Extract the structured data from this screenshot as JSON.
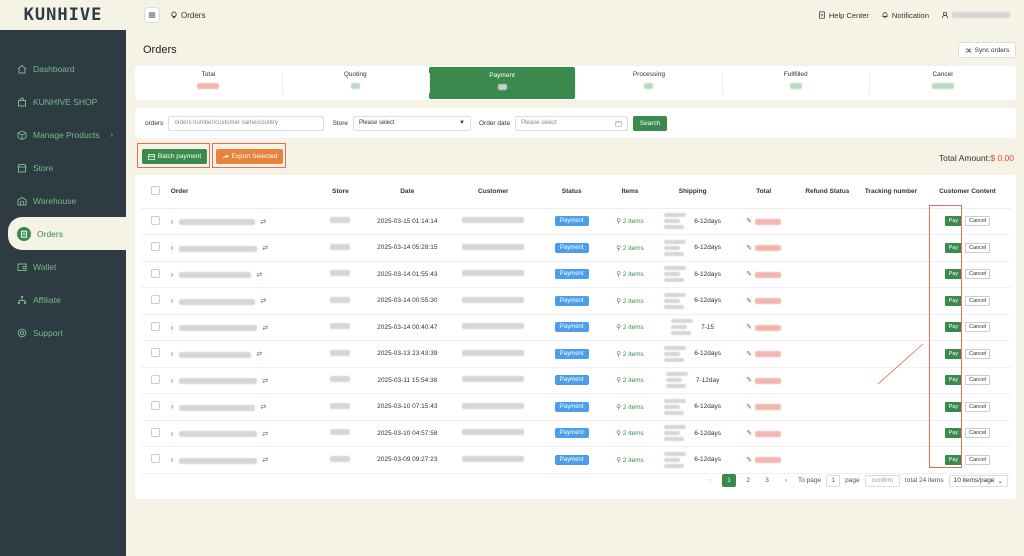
{
  "app": {
    "logo": "KUNHIVE"
  },
  "sidebar": {
    "items": [
      {
        "label": "Dashboard",
        "icon": "home-icon"
      },
      {
        "label": "KUNHIVE SHOP",
        "icon": "bag-icon"
      },
      {
        "label": "Manage Products",
        "icon": "box-icon",
        "chevron": "›"
      },
      {
        "label": "Store",
        "icon": "store-icon"
      },
      {
        "label": "Warehouse",
        "icon": "warehouse-icon"
      },
      {
        "label": "Orders",
        "icon": "clipboard-icon",
        "active": true
      },
      {
        "label": "Wallet",
        "icon": "wallet-icon"
      },
      {
        "label": "Affiliate",
        "icon": "network-icon"
      },
      {
        "label": "Support",
        "icon": "support-icon"
      }
    ]
  },
  "header": {
    "breadcrumb": "Orders",
    "help_center": "Help Center",
    "notification": "Notification"
  },
  "page": {
    "title": "Orders",
    "sync_label": "Sync orders"
  },
  "stats": [
    {
      "label": "Total",
      "color": "#f3b7ae"
    },
    {
      "label": "Quoting",
      "color": "#b9d9c0"
    },
    {
      "label": "Payment",
      "color": "#cfcfcf",
      "active": true
    },
    {
      "label": "Processing",
      "color": "#b9d9c0"
    },
    {
      "label": "Fullfilled",
      "color": "#b9d9c0"
    },
    {
      "label": "Cancel",
      "color": "#b9d9c0"
    }
  ],
  "filters": {
    "orders_label": "orders",
    "orders_placeholder": "orders number/customer name/country",
    "store_label": "Store",
    "store_value": "Please select",
    "order_date_label": "Order date",
    "order_date_placeholder": "Please select",
    "search_label": "Search"
  },
  "actions": {
    "batch_payment": "Batch payment",
    "export_selected": "Export Selected",
    "total_amount_label": "Total Amount:",
    "total_amount_value": "$ 0.00"
  },
  "table": {
    "columns": [
      "Order",
      "Store",
      "Date",
      "Customer",
      "Status",
      "Items",
      "Shipping",
      "Total",
      "Refund Status",
      "Tracking number",
      "Customer Content"
    ],
    "rows": [
      {
        "date": "2025-03-15 01:14:14",
        "status": "Payment",
        "items": "2 items",
        "shipping": "6-12days",
        "pay": "Pay",
        "cancel": "Cancel"
      },
      {
        "date": "2025-03-14 05:28:15",
        "status": "Payment",
        "items": "2 items",
        "shipping": "6-12days",
        "pay": "Pay",
        "cancel": "Cancel"
      },
      {
        "date": "2025-03-14 01:55:43",
        "status": "Payment",
        "items": "2 items",
        "shipping": "6-12days",
        "pay": "Pay",
        "cancel": "Cancel"
      },
      {
        "date": "2025-03-14 00:55:30",
        "status": "Payment",
        "items": "2 items",
        "shipping": "6-12days",
        "pay": "Pay",
        "cancel": "Cancel"
      },
      {
        "date": "2025-03-14 00:40:47",
        "status": "Payment",
        "items": "2 items",
        "shipping": "7-15",
        "pay": "Pay",
        "cancel": "Cancel"
      },
      {
        "date": "2025-03-13 23:43:39",
        "status": "Payment",
        "items": "2 items",
        "shipping": "6-12days",
        "pay": "Pay",
        "cancel": "Cancel"
      },
      {
        "date": "2025-03-11 15:54:38",
        "status": "Payment",
        "items": "2 items",
        "shipping": "7-12day",
        "pay": "Pay",
        "cancel": "Cancel"
      },
      {
        "date": "2025-03-10 07:15:43",
        "status": "Payment",
        "items": "2 items",
        "shipping": "6-12days",
        "pay": "Pay",
        "cancel": "Cancel"
      },
      {
        "date": "2025-03-10 04:57:58",
        "status": "Payment",
        "items": "2 items",
        "shipping": "6-12days",
        "pay": "Pay",
        "cancel": "Cancel"
      },
      {
        "date": "2025-03-09 09:27:23",
        "status": "Payment",
        "items": "2 items",
        "shipping": "6-12days",
        "pay": "Pay",
        "cancel": "Cancel"
      }
    ]
  },
  "pagination": {
    "prev": "‹",
    "pages": [
      "1",
      "2",
      "3"
    ],
    "next": "›",
    "to_page": "To page",
    "page_value": "1",
    "page_word": "page",
    "confirm": "confirm",
    "total": "total 24 items",
    "page_size": "10 items/page"
  }
}
